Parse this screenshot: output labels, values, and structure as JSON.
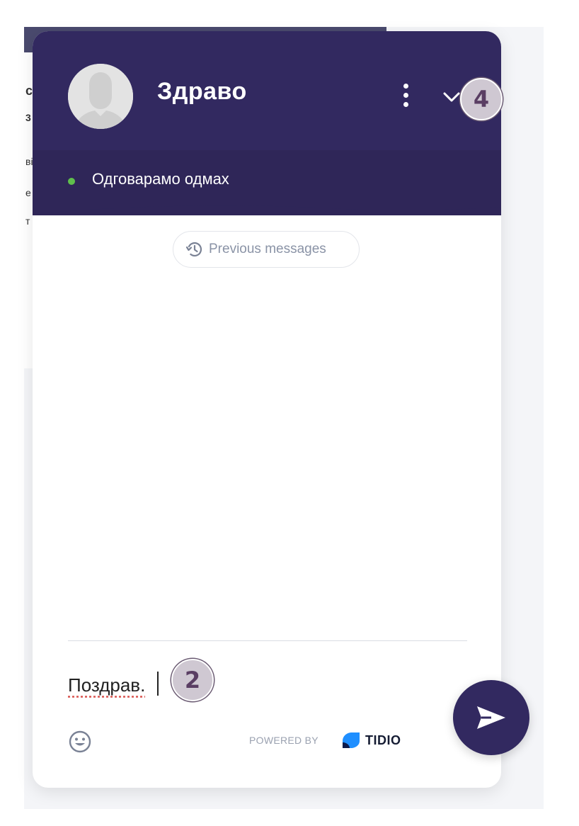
{
  "widget": {
    "title": "Здраво",
    "status": "Одговарамо одмах",
    "status_color": "#5fbf4c",
    "header_color": "#322960",
    "previous_messages_label": "Previous messages",
    "input_value": "Поздрав.",
    "powered_by": "POWERED BY",
    "brand_name": "TIDIO",
    "icons": {
      "avatar": "avatar-icon",
      "menu": "vertical-dots-icon",
      "minimize": "chevron-down-icon",
      "history": "history-icon",
      "emoji": "smiley-icon",
      "send": "send-icon",
      "brand": "tidio-logo-icon"
    }
  },
  "badges": {
    "step_4": "4",
    "step_2": "2"
  }
}
